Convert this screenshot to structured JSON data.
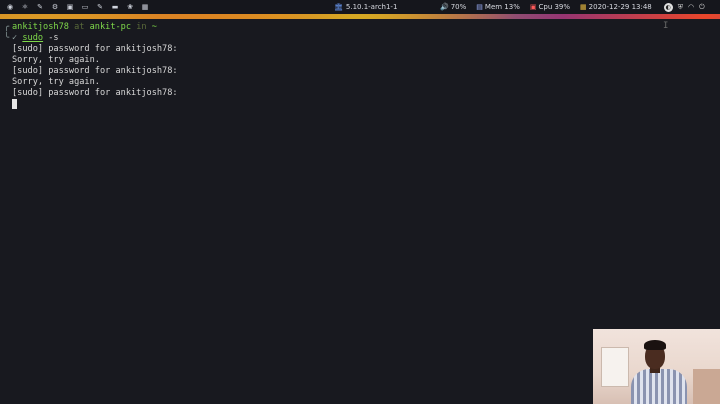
{
  "panel": {
    "launchers": [
      {
        "icon": "app-menu-icon",
        "glyph": "◉"
      },
      {
        "icon": "atom-editor-icon",
        "glyph": "⚛"
      },
      {
        "icon": "dropper-icon",
        "glyph": "✎"
      },
      {
        "icon": "settings-icon",
        "glyph": "⚙"
      },
      {
        "icon": "image-viewer-icon",
        "glyph": "▣"
      },
      {
        "icon": "monitor-icon",
        "glyph": "▭"
      },
      {
        "icon": "code-icon",
        "glyph": "✎"
      },
      {
        "icon": "folder-icon",
        "glyph": "▬"
      },
      {
        "icon": "paw-icon",
        "glyph": "❀"
      },
      {
        "icon": "grid-icon",
        "glyph": "▦"
      }
    ],
    "kernel": "5.10.1-arch1-1",
    "volume": "70%",
    "memory": "Mem 13%",
    "cpu": "Cpu  39%",
    "datetime": "2020-12-29 13:48"
  },
  "terminal": {
    "prompt_user": "ankitjosh78",
    "prompt_at": " at ",
    "prompt_host": "ankit-pc",
    "prompt_in": " in ",
    "prompt_dir": "~",
    "command": "sudo",
    "command_args": " -s",
    "output": [
      "[sudo] password for ankitjosh78:",
      "Sorry, try again.",
      "[sudo] password for ankitjosh78:",
      "Sorry, try again.",
      "[sudo] password for ankitjosh78:"
    ]
  },
  "colors": {
    "prompt_green": "#7fd94a",
    "terminal_bg": "#18191f",
    "panel_bg": "#15161c"
  }
}
